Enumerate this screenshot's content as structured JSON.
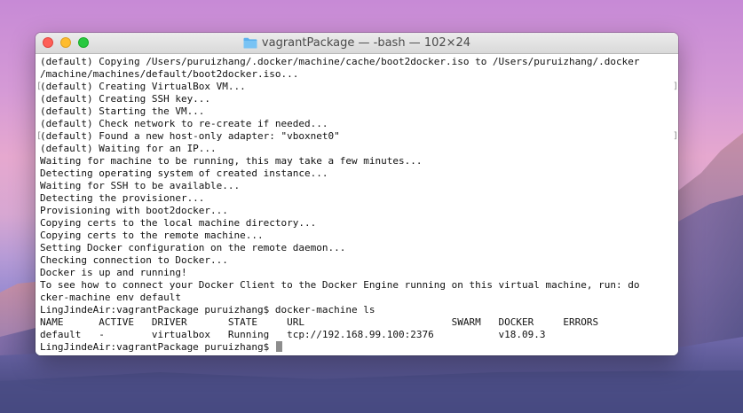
{
  "window": {
    "title": "vagrantPackage — -bash — 102×24",
    "folder_icon": "folder-icon"
  },
  "colors": {
    "close": "#fe5f57",
    "minimize": "#febc2e",
    "zoom": "#28c840",
    "folder": "#5ab0ee"
  },
  "terminal": {
    "lines": [
      "(default) Copying /Users/puruizhang/.docker/machine/cache/boot2docker.iso to /Users/puruizhang/.docker",
      "/machine/machines/default/boot2docker.iso...",
      "(default) Creating VirtualBox VM...",
      "(default) Creating SSH key...",
      "(default) Starting the VM...",
      "(default) Check network to re-create if needed...",
      "(default) Found a new host-only adapter: \"vboxnet0\"",
      "(default) Waiting for an IP...",
      "Waiting for machine to be running, this may take a few minutes...",
      "Detecting operating system of created instance...",
      "Waiting for SSH to be available...",
      "Detecting the provisioner...",
      "Provisioning with boot2docker...",
      "Copying certs to the local machine directory...",
      "Copying certs to the remote machine...",
      "Setting Docker configuration on the remote daemon...",
      "Checking connection to Docker...",
      "Docker is up and running!",
      "To see how to connect your Docker Client to the Docker Engine running on this virtual machine, run: do",
      "cker-machine env default",
      "LingJindeAir:vagrantPackage puruizhang$ docker-machine ls",
      "NAME      ACTIVE   DRIVER       STATE     URL                         SWARM   DOCKER     ERRORS",
      "default   -        virtualbox   Running   tcp://192.168.99.100:2376           v18.09.3"
    ],
    "prompt": "LingJindeAir:vagrantPackage puruizhang$ "
  }
}
